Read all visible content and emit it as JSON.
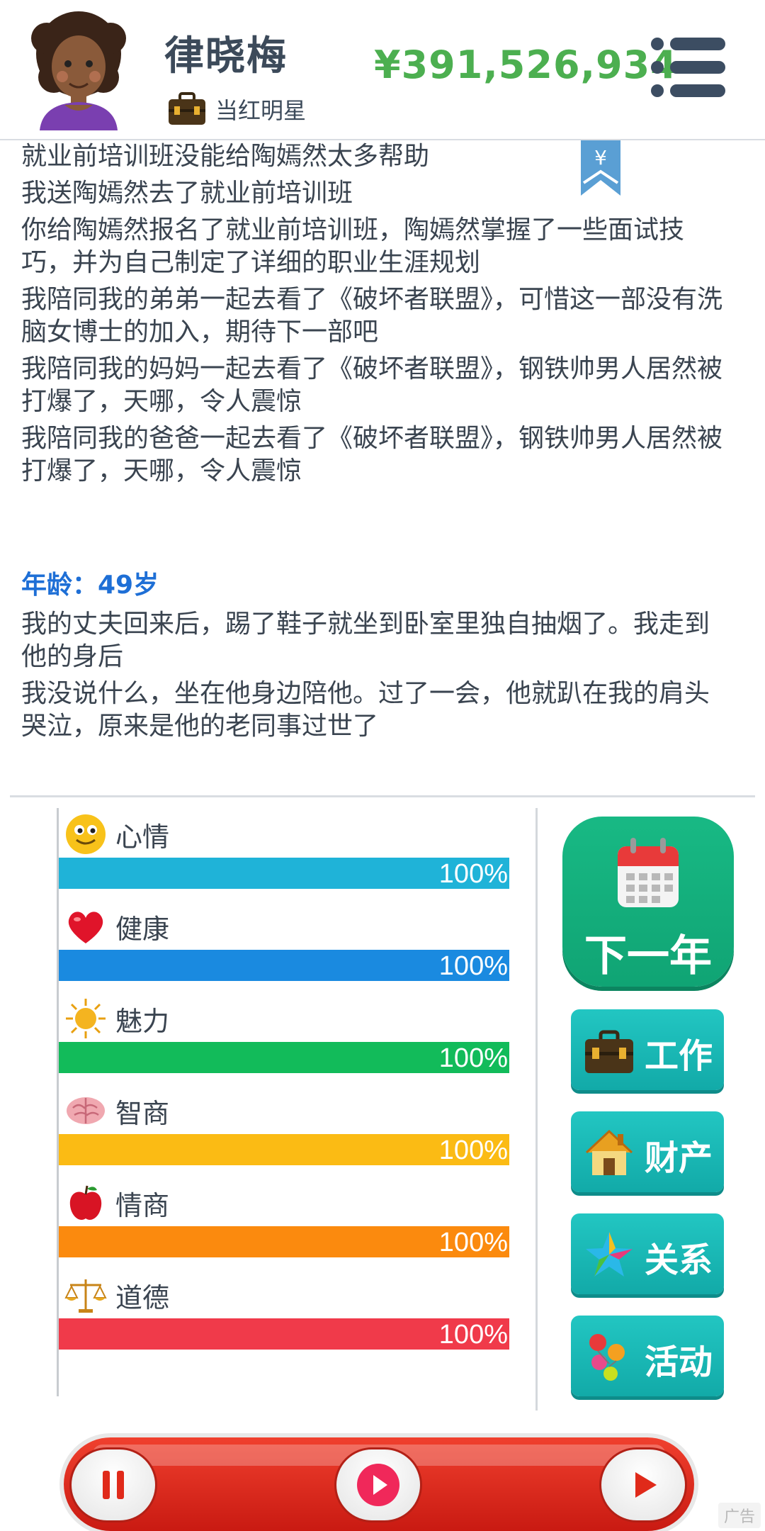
{
  "header": {
    "player_name": "律晓梅",
    "job_title": "当红明星",
    "money": "¥391,526,934",
    "avatar_icon": "avatar-woman-curly-hair",
    "job_icon": "briefcase-icon",
    "menu_icon": "menu-list-icon"
  },
  "bookmark": {
    "symbol": "¥",
    "icon": "yen-bookmark-icon"
  },
  "log": {
    "previous_entries": [
      "就业前培训班没能给陶嫣然太多帮助",
      "我送陶嫣然去了就业前培训班",
      "你给陶嫣然报名了就业前培训班，陶嫣然掌握了一些面试技巧，并为自己制定了详细的职业生涯规划",
      "我陪同我的弟弟一起去看了《破坏者联盟》，可惜这一部没有洗脑女博士的加入，期待下一部吧",
      "我陪同我的妈妈一起去看了《破坏者联盟》，钢铁帅男人居然被打爆了，天哪，令人震惊",
      "我陪同我的爸爸一起去看了《破坏者联盟》，钢铁帅男人居然被打爆了，天哪，令人震惊"
    ],
    "age_label": "年龄：49岁",
    "current_entries": [
      "我的丈夫回来后，踢了鞋子就坐到卧室里独自抽烟了。我走到他的身后",
      "我没说什么，坐在他身边陪他。过了一会，他就趴在我的肩头哭泣，原来是他的老同事过世了"
    ]
  },
  "stats": [
    {
      "label": "心情",
      "value": "100%",
      "level": 1.0,
      "color": "#1fb3d8",
      "icon": "smiley-icon"
    },
    {
      "label": "健康",
      "value": "100%",
      "level": 1.0,
      "color": "#1a8ae0",
      "icon": "heart-icon"
    },
    {
      "label": "魅力",
      "value": "100%",
      "level": 1.0,
      "color": "#12bb5a",
      "icon": "sun-icon"
    },
    {
      "label": "智商",
      "value": "100%",
      "level": 1.0,
      "color": "#fbbb14",
      "icon": "brain-icon"
    },
    {
      "label": "情商",
      "value": "100%",
      "level": 1.0,
      "color": "#fb8a0e",
      "icon": "apple-icon"
    },
    {
      "label": "道德",
      "value": "100%",
      "level": 1.0,
      "color": "#f03a4a",
      "icon": "scales-icon"
    }
  ],
  "actions": {
    "next_year": {
      "label": "下一年",
      "icon": "calendar-icon"
    },
    "work": {
      "label": "工作",
      "icon": "briefcase-icon"
    },
    "property": {
      "label": "财产",
      "icon": "house-icon"
    },
    "relations": {
      "label": "关系",
      "icon": "star-icon"
    },
    "activities": {
      "label": "活动",
      "icon": "balloons-icon"
    }
  },
  "controls": {
    "pause_icon": "pause-icon",
    "record_icon": "record-icon",
    "play_icon": "play-icon"
  },
  "ad_badge": "广告"
}
